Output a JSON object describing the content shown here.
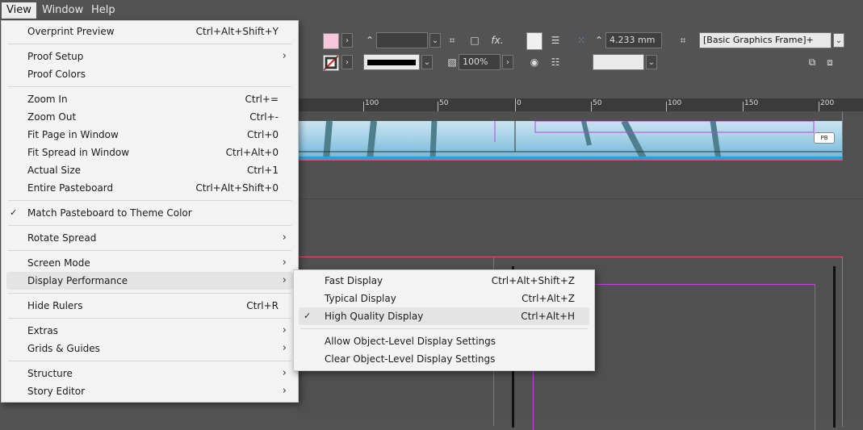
{
  "menubar": {
    "items": [
      "View",
      "Window",
      "Help"
    ]
  },
  "toolbar": {
    "stroke_weight": "",
    "zoom": "100%",
    "measure": "4.233 mm",
    "object_style": "[Basic Graphics Frame]+",
    "fx_label": "fx."
  },
  "ruler": {
    "labels": [
      "100",
      "50",
      "0",
      "50",
      "100",
      "150",
      "200"
    ]
  },
  "canvas": {
    "badge": "PB"
  },
  "view_menu": {
    "items": [
      {
        "label": "Overprint Preview",
        "shortcut": "Ctrl+Alt+Shift+Y"
      },
      {
        "label": "Proof Setup",
        "shortcut": ""
      },
      {
        "label": "Proof Colors",
        "shortcut": ""
      },
      {
        "label": "Zoom In",
        "shortcut": "Ctrl+="
      },
      {
        "label": "Zoom Out",
        "shortcut": "Ctrl+-"
      },
      {
        "label": "Fit Page in Window",
        "shortcut": "Ctrl+0"
      },
      {
        "label": "Fit Spread in Window",
        "shortcut": "Ctrl+Alt+0"
      },
      {
        "label": "Actual Size",
        "shortcut": "Ctrl+1"
      },
      {
        "label": "Entire Pasteboard",
        "shortcut": "Ctrl+Alt+Shift+0"
      },
      {
        "label": "Match Pasteboard to Theme Color",
        "shortcut": ""
      },
      {
        "label": "Rotate Spread",
        "shortcut": ""
      },
      {
        "label": "Screen Mode",
        "shortcut": ""
      },
      {
        "label": "Display Performance",
        "shortcut": ""
      },
      {
        "label": "Hide Rulers",
        "shortcut": "Ctrl+R"
      },
      {
        "label": "Extras",
        "shortcut": ""
      },
      {
        "label": "Grids & Guides",
        "shortcut": ""
      },
      {
        "label": "Structure",
        "shortcut": ""
      },
      {
        "label": "Story Editor",
        "shortcut": ""
      }
    ]
  },
  "display_submenu": {
    "items": [
      {
        "label": "Fast Display",
        "shortcut": "Ctrl+Alt+Shift+Z"
      },
      {
        "label": "Typical Display",
        "shortcut": "Ctrl+Alt+Z"
      },
      {
        "label": "High Quality Display",
        "shortcut": "Ctrl+Alt+H"
      },
      {
        "label": "Allow Object-Level Display Settings",
        "shortcut": ""
      },
      {
        "label": "Clear Object-Level Display Settings",
        "shortcut": ""
      }
    ]
  },
  "icons": {
    "submenu_arrow": "chevron-right-icon",
    "checkmark": "checkmark-icon"
  }
}
